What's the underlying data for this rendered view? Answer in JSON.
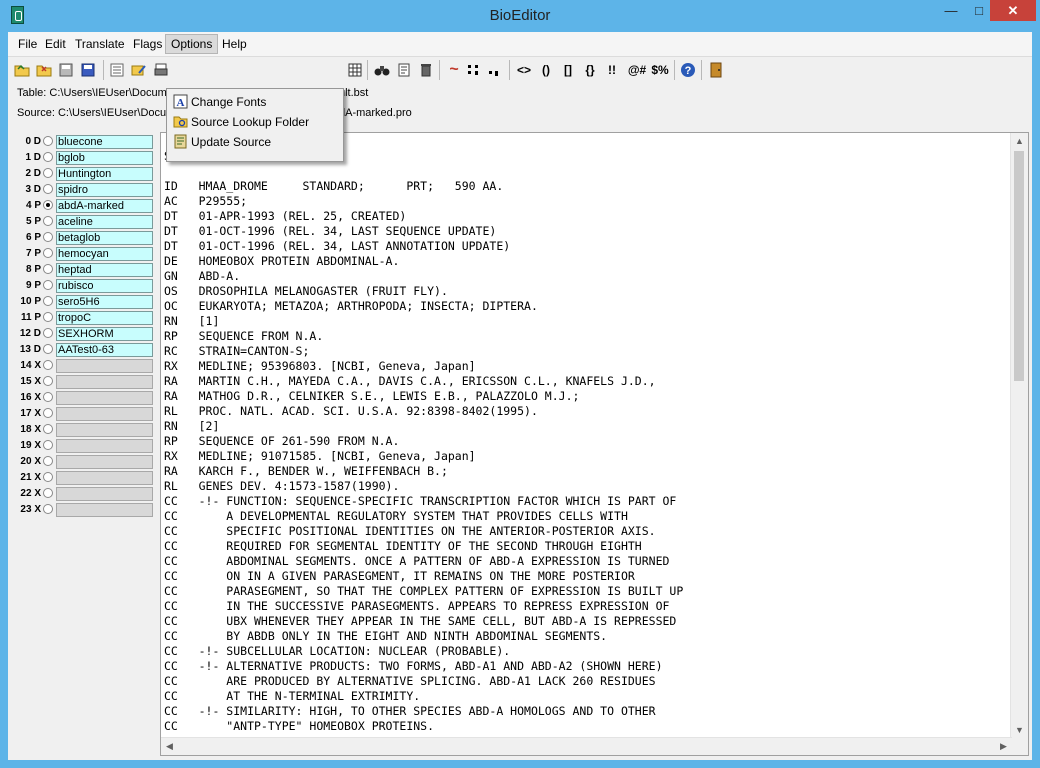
{
  "window": {
    "title": "BioEditor"
  },
  "menubar": {
    "items": [
      "File",
      "Edit",
      "Translate",
      "Flags",
      "Options",
      "Help"
    ],
    "open_item": "Options"
  },
  "options_menu": {
    "items": [
      "Change Fonts",
      "Source Lookup Folder",
      "Update Source"
    ]
  },
  "toolbar": {
    "text_buttons": [
      "<>",
      "()",
      "[]",
      "{}",
      "!!",
      "@#",
      "$%"
    ]
  },
  "info": {
    "table_line": "Table: C:\\Users\\IEUser\\Docum",
    "table_tail": "ult.bst",
    "source_line": "Source: C:\\Users\\IEUser\\Docu",
    "source_tail": "dA-marked.pro"
  },
  "sequences": [
    {
      "num": "0",
      "flag": "D",
      "name": "bluecone",
      "selected": false
    },
    {
      "num": "1",
      "flag": "D",
      "name": "bglob",
      "selected": false
    },
    {
      "num": "2",
      "flag": "D",
      "name": "Huntington",
      "selected": false
    },
    {
      "num": "3",
      "flag": "D",
      "name": "spidro",
      "selected": false
    },
    {
      "num": "4",
      "flag": "P",
      "name": "abdA-marked",
      "selected": true
    },
    {
      "num": "5",
      "flag": "P",
      "name": "aceline",
      "selected": false
    },
    {
      "num": "6",
      "flag": "P",
      "name": "betaglob",
      "selected": false
    },
    {
      "num": "7",
      "flag": "P",
      "name": "hemocyan",
      "selected": false
    },
    {
      "num": "8",
      "flag": "P",
      "name": "heptad",
      "selected": false
    },
    {
      "num": "9",
      "flag": "P",
      "name": "rubisco",
      "selected": false
    },
    {
      "num": "10",
      "flag": "P",
      "name": "sero5H6",
      "selected": false
    },
    {
      "num": "11",
      "flag": "P",
      "name": "tropoC",
      "selected": false
    },
    {
      "num": "12",
      "flag": "D",
      "name": "SEXHORM",
      "selected": false
    },
    {
      "num": "13",
      "flag": "D",
      "name": "AATest0-63",
      "selected": false
    },
    {
      "num": "14",
      "flag": "X",
      "name": "",
      "selected": false
    },
    {
      "num": "15",
      "flag": "X",
      "name": "",
      "selected": false
    },
    {
      "num": "16",
      "flag": "X",
      "name": "",
      "selected": false
    },
    {
      "num": "17",
      "flag": "X",
      "name": "",
      "selected": false
    },
    {
      "num": "18",
      "flag": "X",
      "name": "",
      "selected": false
    },
    {
      "num": "19",
      "flag": "X",
      "name": "",
      "selected": false
    },
    {
      "num": "20",
      "flag": "X",
      "name": "",
      "selected": false
    },
    {
      "num": "21",
      "flag": "X",
      "name": "",
      "selected": false
    },
    {
      "num": "22",
      "flag": "X",
      "name": "",
      "selected": false
    },
    {
      "num": "23",
      "flag": "X",
      "name": "",
      "selected": false
    }
  ],
  "editor": {
    "lines": [
      "SWISS-PROT: P29555",
      "",
      "ID   HMAA_DROME     STANDARD;      PRT;   590 AA.",
      "AC   P29555;",
      "DT   01-APR-1993 (REL. 25, CREATED)",
      "DT   01-OCT-1996 (REL. 34, LAST SEQUENCE UPDATE)",
      "DT   01-OCT-1996 (REL. 34, LAST ANNOTATION UPDATE)",
      "DE   HOMEOBOX PROTEIN ABDOMINAL-A.",
      "GN   ABD-A.",
      "OS   DROSOPHILA MELANOGASTER (FRUIT FLY).",
      "OC   EUKARYOTA; METAZOA; ARTHROPODA; INSECTA; DIPTERA.",
      "RN   [1]",
      "RP   SEQUENCE FROM N.A.",
      "RC   STRAIN=CANTON-S;",
      "RX   MEDLINE; 95396803. [NCBI, Geneva, Japan]",
      "RA   MARTIN C.H., MAYEDA C.A., DAVIS C.A., ERICSSON C.L., KNAFELS J.D.,",
      "RA   MATHOG D.R., CELNIKER S.E., LEWIS E.B., PALAZZOLO M.J.;",
      "RL   PROC. NATL. ACAD. SCI. U.S.A. 92:8398-8402(1995).",
      "RN   [2]",
      "RP   SEQUENCE OF 261-590 FROM N.A.",
      "RX   MEDLINE; 91071585. [NCBI, Geneva, Japan]",
      "RA   KARCH F., BENDER W., WEIFFENBACH B.;",
      "RL   GENES DEV. 4:1573-1587(1990).",
      "CC   -!- FUNCTION: SEQUENCE-SPECIFIC TRANSCRIPTION FACTOR WHICH IS PART OF",
      "CC       A DEVELOPMENTAL REGULATORY SYSTEM THAT PROVIDES CELLS WITH",
      "CC       SPECIFIC POSITIONAL IDENTITIES ON THE ANTERIOR-POSTERIOR AXIS.",
      "CC       REQUIRED FOR SEGMENTAL IDENTITY OF THE SECOND THROUGH EIGHTH",
      "CC       ABDOMINAL SEGMENTS. ONCE A PATTERN OF ABD-A EXPRESSION IS TURNED",
      "CC       ON IN A GIVEN PARASEGMENT, IT REMAINS ON THE MORE POSTERIOR",
      "CC       PARASEGMENT, SO THAT THE COMPLEX PATTERN OF EXPRESSION IS BUILT UP",
      "CC       IN THE SUCCESSIVE PARASEGMENTS. APPEARS TO REPRESS EXPRESSION OF",
      "CC       UBX WHENEVER THEY APPEAR IN THE SAME CELL, BUT ABD-A IS REPRESSED",
      "CC       BY ABDB ONLY IN THE EIGHT AND NINTH ABDOMINAL SEGMENTS.",
      "CC   -!- SUBCELLULAR LOCATION: NUCLEAR (PROBABLE).",
      "CC   -!- ALTERNATIVE PRODUCTS: TWO FORMS, ABD-A1 AND ABD-A2 (SHOWN HERE)",
      "CC       ARE PRODUCED BY ALTERNATIVE SPLICING. ABD-A1 LACK 260 RESIDUES",
      "CC       AT THE N-TERMINAL EXTRIMITY.",
      "CC   -!- SIMILARITY: HIGH, TO OTHER SPECIES ABD-A HOMOLOGS AND TO OTHER",
      "CC       \"ANTP-TYPE\" HOMEOBOX PROTEINS."
    ]
  },
  "colors": {
    "titlebar": "#5db4e8",
    "close_button": "#c7423a",
    "sequence_filled": "#c8fdfd",
    "sequence_empty": "#d8d8d8"
  }
}
